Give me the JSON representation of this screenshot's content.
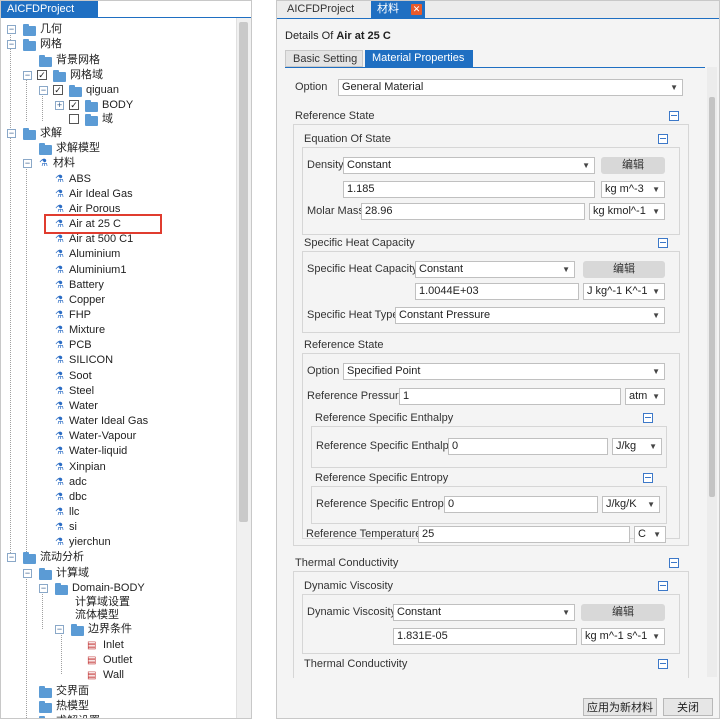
{
  "left_panel": {
    "tab_title": "AICFDProject",
    "tree": [
      {
        "label": "几何"
      },
      {
        "label": "网格"
      },
      {
        "label": "背景网格"
      },
      {
        "label": "网格域"
      },
      {
        "label": "qiguan"
      },
      {
        "label": "BODY"
      },
      {
        "label": "域"
      },
      {
        "label": "求解"
      },
      {
        "label": "求解模型"
      },
      {
        "label": "材料"
      },
      {
        "label": "ABS"
      },
      {
        "label": "Air Ideal Gas"
      },
      {
        "label": "Air Porous"
      },
      {
        "label": "Air at 25 C"
      },
      {
        "label": "Air at 500 C1"
      },
      {
        "label": "Aluminium"
      },
      {
        "label": "Aluminium1"
      },
      {
        "label": "Battery"
      },
      {
        "label": "Copper"
      },
      {
        "label": "FHP"
      },
      {
        "label": "Mixture"
      },
      {
        "label": "PCB"
      },
      {
        "label": "SILICON"
      },
      {
        "label": "Soot"
      },
      {
        "label": "Steel"
      },
      {
        "label": "Water"
      },
      {
        "label": "Water Ideal Gas"
      },
      {
        "label": "Water-Vapour"
      },
      {
        "label": "Water-liquid"
      },
      {
        "label": "Xinpian"
      },
      {
        "label": "adc"
      },
      {
        "label": "dbc"
      },
      {
        "label": "llc"
      },
      {
        "label": "si"
      },
      {
        "label": "yierchun"
      },
      {
        "label": "流动分析"
      },
      {
        "label": "计算域"
      },
      {
        "label": "Domain-BODY"
      },
      {
        "label": "计算域设置"
      },
      {
        "label": "流体模型"
      },
      {
        "label": "边界条件"
      },
      {
        "label": "Inlet"
      },
      {
        "label": "Outlet"
      },
      {
        "label": "Wall"
      },
      {
        "label": "交界面"
      },
      {
        "label": "热模型"
      },
      {
        "label": "求解设置"
      }
    ]
  },
  "right_panel": {
    "tabs": [
      {
        "label": "AICFDProject"
      },
      {
        "label": "材料"
      }
    ],
    "details_prefix": "Details Of",
    "details_name": "Air at 25 C",
    "subtabs": [
      {
        "label": "Basic Setting"
      },
      {
        "label": "Material Properties"
      }
    ],
    "option_label": "Option",
    "option_value": "General Material",
    "reference_state": {
      "title": "Reference State",
      "eos": {
        "title": "Equation Of State",
        "density_label": "Density",
        "density_value": "Constant",
        "edit_label": "编辑",
        "density_number": "1.185",
        "density_unit": "kg m^-3",
        "molar_label": "Molar Mass",
        "molar_value": "28.96",
        "molar_unit": "kg kmol^-1"
      },
      "shc": {
        "title": "Specific Heat Capacity",
        "label": "Specific Heat Capacity",
        "value": "Constant",
        "edit_label": "编辑",
        "number": "1.0044E+03",
        "unit": "J kg^-1 K^-1",
        "type_label": "Specific Heat Type",
        "type_value": "Constant Pressure"
      },
      "ref": {
        "title": "Reference State",
        "option_label": "Option",
        "option_value": "Specified Point",
        "pressure_label": "Reference Pressure",
        "pressure_value": "1",
        "pressure_unit": "atm",
        "enthalpy_group": "Reference Specific Enthalpy",
        "enthalpy_label": "Reference Specific Enthalpy",
        "enthalpy_value": "0",
        "enthalpy_unit": "J/kg",
        "entropy_group": "Reference Specific Entropy",
        "entropy_label": "Reference Specific Entropy",
        "entropy_value": "0",
        "entropy_unit": "J/kg/K",
        "temp_label": "Reference Temperature",
        "temp_value": "25",
        "temp_unit": "C"
      }
    },
    "thermal": {
      "title": "Thermal Conductivity",
      "dyn_title": "Dynamic Viscosity",
      "dyn_label": "Dynamic Viscosity",
      "dyn_value": "Constant",
      "edit_label": "编辑",
      "dyn_number": "1.831E-05",
      "dyn_unit": "kg m^-1 s^-1",
      "tc_title": "Thermal Conductivity"
    },
    "bottom_buttons": {
      "apply": "应用为新材料",
      "close": "关闭"
    }
  }
}
